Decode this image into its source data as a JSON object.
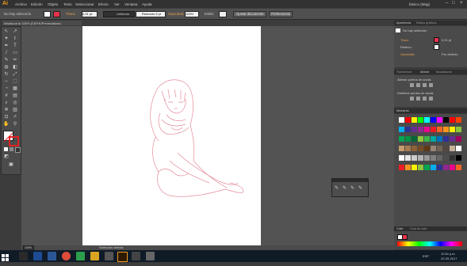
{
  "app": {
    "logo": "Ai"
  },
  "menubar": {
    "items": [
      "Archivo",
      "Edición",
      "Objeto",
      "Texto",
      "Seleccionar",
      "Efecto",
      "Ver",
      "Ventana",
      "Ayuda"
    ],
    "workspace": "básico (Mag)"
  },
  "controlbar": {
    "selection": "No hay selección",
    "trazo_label": "Trazo:",
    "trazo_value": "0,01 pt",
    "uniforme": "Uniforme",
    "brush": "Redondo 5 pt",
    "opacity_label": "Opacidad:",
    "opacity_value": "100%",
    "estilo_label": "Estilo:",
    "ajustar": "Ajustar documento",
    "preferencias": "Preferencias"
  },
  "document": {
    "tab": "Nina6a.ai al 100% (CMYK/Previsualizar)"
  },
  "statusbar": {
    "zoom": "100%",
    "tool": "Selección directa"
  },
  "panels": {
    "apariencia": {
      "tabs": [
        "Apariencia",
        "Estilos gráficos"
      ],
      "header": "No hay selección",
      "rows": [
        {
          "label": "Trazo:",
          "value": "0,01 pt"
        },
        {
          "label": "Relleno:",
          "value": ""
        },
        {
          "label": "Opacidad:",
          "value": "Por defecto"
        }
      ]
    },
    "alinear": {
      "tabs": [
        "Transformar",
        "Alinear",
        "Buscatrazos"
      ],
      "section1": "Alinear puntos de ancla:",
      "section2": "Distribuir puntos de ancla:"
    },
    "muestras": {
      "tab": "Muestras"
    },
    "color": {
      "tabs": [
        "Color",
        "Guía de color"
      ]
    }
  },
  "taskbar": {
    "time": "11:54 p.m.",
    "date": "22-09-2017",
    "lang": "ESP"
  },
  "colors": {
    "swatches_row1": [
      "#ffffff",
      "#ff0000",
      "#fff200",
      "#00ff00",
      "#00ffff",
      "#0000ff",
      "#ff00ff",
      "#000000",
      "#ff0000",
      "#ff4000"
    ],
    "swatches_row2": [
      "#00aeef",
      "#2e3192",
      "#662d91",
      "#92278f",
      "#ec008c",
      "#ed1c24",
      "#f26522",
      "#f7941d",
      "#fff200",
      "#8dc63f"
    ],
    "swatches_row3": [
      "#00a651",
      "#009245",
      "#006837",
      "#8dc63f",
      "#39b54a",
      "#00a99d",
      "#0072bc",
      "#2e3192",
      "#662d91",
      "#9e005d"
    ],
    "swatches_row4": [
      "#c69c6d",
      "#a67c52",
      "#8c6239",
      "#754c24",
      "#603913",
      "#998675",
      "#736357",
      "#534741",
      "#c7b299",
      "#ffffff"
    ],
    "swatches_row5": [
      "#ffffff",
      "#e6e6e6",
      "#cccccc",
      "#b3b3b3",
      "#999999",
      "#808080",
      "#666666",
      "#4d4d4d",
      "#333333",
      "#000000"
    ],
    "swatches_row6": [
      "#ed1c24",
      "#f7941d",
      "#fff200",
      "#8dc63f",
      "#00a651",
      "#00aeef",
      "#2e3192",
      "#92278f",
      "#ec008c",
      "#f26522"
    ]
  }
}
